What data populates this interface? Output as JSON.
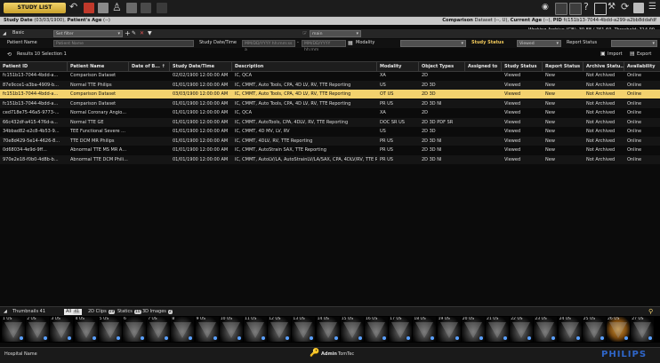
{
  "toolbar": {
    "study_list_label": "STUDY LIST",
    "icons": [
      "undo-icon",
      "delete-icon",
      "user-icon",
      "export-icon",
      "study-icon",
      "print-icon"
    ],
    "right_icons": [
      "eye-icon",
      "grid-icon",
      "layout-icon",
      "help-icon",
      "fullscreen-icon",
      "tools-icon",
      "sync-icon",
      "window-icon",
      "menu-icon"
    ]
  },
  "infobar": {
    "study_date_label": "Study Date",
    "study_date_value": "(03/03/1900)",
    "patient_age_label": "Patient's Age",
    "patient_age_value": "(--)",
    "right_text_pre": "Comparison",
    "right_text_mid": " Dataset (--, U), ",
    "current_age_label": "Current Age",
    "current_age_value": " (--), ",
    "pid_label": "PID",
    "pid_value": " fc151b13-7044-4bdd-a299-a2bb8ddafdf"
  },
  "status": {
    "archive": "Working Archive (GB): 30.88 / 761.60, Threshold: 714.00"
  },
  "filters": {
    "basic_label": "Basic",
    "set_filter_placeholder": "Set filter",
    "main_select": "main",
    "patient_name_label": "Patient Name",
    "patient_name_placeholder": "Patient Name",
    "study_datetime_label": "Study Date/Time",
    "date_from_placeholder": "MM/DD/YYYY hh:mm:ss a",
    "date_to_placeholder": "MM/DD/YYYY hh:mm",
    "modality_label": "Modality",
    "study_status_label": "Study Status",
    "study_status_value": "Viewed",
    "report_status_label": "Report Status"
  },
  "results": {
    "results_label": "Results",
    "results_count": "10",
    "selection_label": "Selection",
    "selection_count": "1",
    "import_label": "Import",
    "export_label": "Export"
  },
  "table": {
    "headers": [
      "Patient ID",
      "Patient Name",
      "Date of B...",
      "Study Date/Time",
      "Description",
      "Modality",
      "Object Types",
      "Assigned to",
      "Study Status",
      "Report Status",
      "Archive Statu...",
      "Availability"
    ],
    "rows": [
      [
        "fc151b13-7044-4bdd-a...",
        "Comparison Dataset",
        "",
        "02/02/1900 12:00:00 AM",
        "IC, QCA",
        "XA",
        "2D",
        "",
        "Viewed",
        "New",
        "Not Archived",
        "Online"
      ],
      [
        "87e9cce1-a3ba-4909-b...",
        "Normal TTE Philips",
        "",
        "01/01/1900 12:00:00 AM",
        "IC, CMMT, Auto Tools, CPA, 4D LV, RV, TTE Reporting",
        "US",
        "2D 3D",
        "",
        "Viewed",
        "New",
        "Not Archived",
        "Online"
      ],
      [
        "fc151b13-7044-4bdd-a...",
        "Comparison Dataset",
        "",
        "03/03/1900 12:00:00 AM",
        "IC, CMMT, Auto Tools, CPA, 4D LV, RV, TTE Reporting",
        "OT US",
        "2D 3D",
        "",
        "Viewed",
        "New",
        "Not Archived",
        "Online"
      ],
      [
        "fc151b13-7044-4bdd-a...",
        "Comparison Dataset",
        "",
        "01/01/1900 12:00:00 AM",
        "IC, CMMT, Auto Tools, CPA, 4D LV, RV, TTE Reporting",
        "PR US",
        "2D 3D NI",
        "",
        "Viewed",
        "New",
        "Not Archived",
        "Online"
      ],
      [
        "ced718e75-46a5-9773-...",
        "Normal Coronary Angio...",
        "",
        "01/01/1900 12:00:00 AM",
        "IC, QCA",
        "XA",
        "2D",
        "",
        "Viewed",
        "New",
        "Not Archived",
        "Online"
      ],
      [
        "66c432df-a415-476d-a...",
        "Normal TTE GE",
        "",
        "01/01/1900 12:00:00 AM",
        "IC, CMMT, AutoTools, CPA, 4DLV, RV, TTE Reporting",
        "DOC SR US",
        "2D 3D PDF SR",
        "",
        "Viewed",
        "New",
        "Not Archived",
        "Online"
      ],
      [
        "34bbad82-e2c8-4b53-9...",
        "TEE Functional Severe ...",
        "",
        "01/01/1900 12:00:00 AM",
        "IC, CMMT, 4D MV, LV, RV",
        "US",
        "2D 3D",
        "",
        "Viewed",
        "New",
        "Not Archived",
        "Online"
      ],
      [
        "70e8d429-5e14-4626-8...",
        "TTE DCM MR Philips",
        "",
        "01/01/1900 12:00:00 AM",
        "IC, CMMT, 4DLV, RV, TTE Reporting",
        "PR US",
        "2D 3D NI",
        "",
        "Viewed",
        "New",
        "Not Archived",
        "Online"
      ],
      [
        "0d68034-4e9d-9ff...",
        "Abnormal TTE MS MR A...",
        "",
        "01/01/1900 12:00:00 AM",
        "IC, CMMT, AutoStrain SAX, TTE Reporting",
        "PR US",
        "2D 3D NI",
        "",
        "Viewed",
        "New",
        "Not Archived",
        "Online"
      ],
      [
        "970e2e18-f0b0-4d8b-b...",
        "Abnormal TTE DCM Phili...",
        "",
        "01/01/1900 12:00:00 AM",
        "IC, CMMT, AutoLV/LA, AutoStrainLV/LA/SAX, CPA, 4DLV/RV, TTE Reporting",
        "PR US",
        "2D 3D NI",
        "",
        "Viewed",
        "New",
        "Not Archived",
        "Online"
      ]
    ]
  },
  "thumbnails": {
    "label": "Thumbnails",
    "count": "41",
    "tabs": [
      {
        "label": "All",
        "count": "41"
      },
      {
        "label": "2D Clips",
        "count": "29"
      },
      {
        "label": "Statics",
        "count": "10"
      },
      {
        "label": "3D Images",
        "count": "2"
      }
    ],
    "items": [
      "1 US",
      "2 US",
      "3 US",
      "4 US",
      "5 US",
      "6",
      "7 US",
      "8",
      "9 US",
      "10 US",
      "11 US",
      "12 US",
      "13 US",
      "14 US",
      "15 US",
      "16 US",
      "17 US",
      "18 US",
      "19 US",
      "20 US",
      "21 US",
      "22 US",
      "23 US",
      "24 US",
      "25 US",
      "26 US",
      "27 US"
    ]
  },
  "footer": {
    "hospital_label": "Hospital Name",
    "user_label": "Admin",
    "user_org": "TomTec",
    "brand": "PHILIPS"
  },
  "colors": {
    "accent": "#f3d26e",
    "brand_blue": "#2f66c9"
  }
}
